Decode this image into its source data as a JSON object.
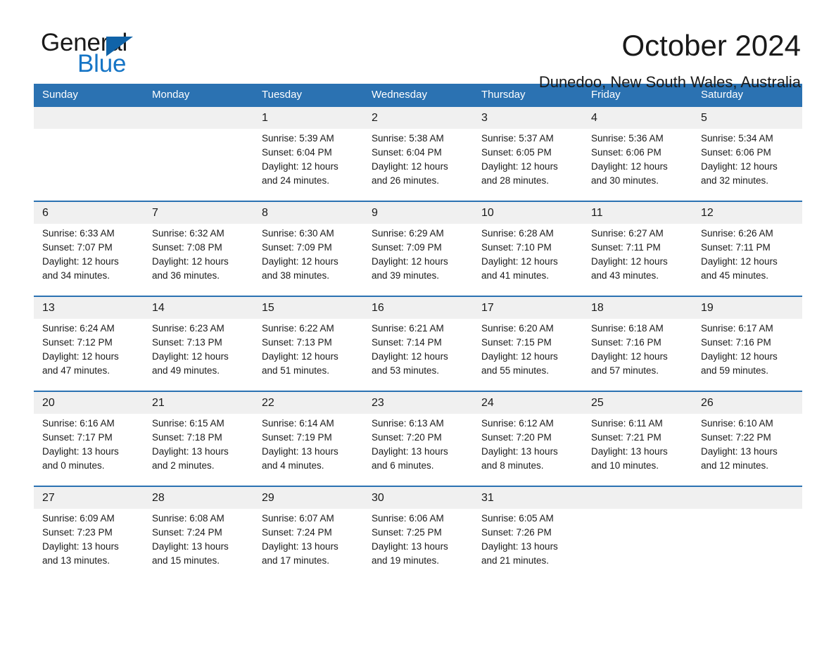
{
  "brand": {
    "word_one": "General",
    "word_two": "Blue",
    "accent_dark": "#1063a8",
    "accent_blue": "#1675c6"
  },
  "header": {
    "title": "October 2024",
    "subtitle": "Dunedoo, New South Wales, Australia"
  },
  "theme": {
    "header_blue": "#2b72b2",
    "daynum_band": "#f0f0f0",
    "cell_white": "#ffffff"
  },
  "calendar": {
    "weekdays": [
      "Sunday",
      "Monday",
      "Tuesday",
      "Wednesday",
      "Thursday",
      "Friday",
      "Saturday"
    ],
    "weeks": [
      [
        {
          "day": "",
          "detail": ""
        },
        {
          "day": "",
          "detail": ""
        },
        {
          "day": "1",
          "detail": "Sunrise: 5:39 AM\nSunset: 6:04 PM\nDaylight: 12 hours\nand 24 minutes."
        },
        {
          "day": "2",
          "detail": "Sunrise: 5:38 AM\nSunset: 6:04 PM\nDaylight: 12 hours\nand 26 minutes."
        },
        {
          "day": "3",
          "detail": "Sunrise: 5:37 AM\nSunset: 6:05 PM\nDaylight: 12 hours\nand 28 minutes."
        },
        {
          "day": "4",
          "detail": "Sunrise: 5:36 AM\nSunset: 6:06 PM\nDaylight: 12 hours\nand 30 minutes."
        },
        {
          "day": "5",
          "detail": "Sunrise: 5:34 AM\nSunset: 6:06 PM\nDaylight: 12 hours\nand 32 minutes."
        }
      ],
      [
        {
          "day": "6",
          "detail": "Sunrise: 6:33 AM\nSunset: 7:07 PM\nDaylight: 12 hours\nand 34 minutes."
        },
        {
          "day": "7",
          "detail": "Sunrise: 6:32 AM\nSunset: 7:08 PM\nDaylight: 12 hours\nand 36 minutes."
        },
        {
          "day": "8",
          "detail": "Sunrise: 6:30 AM\nSunset: 7:09 PM\nDaylight: 12 hours\nand 38 minutes."
        },
        {
          "day": "9",
          "detail": "Sunrise: 6:29 AM\nSunset: 7:09 PM\nDaylight: 12 hours\nand 39 minutes."
        },
        {
          "day": "10",
          "detail": "Sunrise: 6:28 AM\nSunset: 7:10 PM\nDaylight: 12 hours\nand 41 minutes."
        },
        {
          "day": "11",
          "detail": "Sunrise: 6:27 AM\nSunset: 7:11 PM\nDaylight: 12 hours\nand 43 minutes."
        },
        {
          "day": "12",
          "detail": "Sunrise: 6:26 AM\nSunset: 7:11 PM\nDaylight: 12 hours\nand 45 minutes."
        }
      ],
      [
        {
          "day": "13",
          "detail": "Sunrise: 6:24 AM\nSunset: 7:12 PM\nDaylight: 12 hours\nand 47 minutes."
        },
        {
          "day": "14",
          "detail": "Sunrise: 6:23 AM\nSunset: 7:13 PM\nDaylight: 12 hours\nand 49 minutes."
        },
        {
          "day": "15",
          "detail": "Sunrise: 6:22 AM\nSunset: 7:13 PM\nDaylight: 12 hours\nand 51 minutes."
        },
        {
          "day": "16",
          "detail": "Sunrise: 6:21 AM\nSunset: 7:14 PM\nDaylight: 12 hours\nand 53 minutes."
        },
        {
          "day": "17",
          "detail": "Sunrise: 6:20 AM\nSunset: 7:15 PM\nDaylight: 12 hours\nand 55 minutes."
        },
        {
          "day": "18",
          "detail": "Sunrise: 6:18 AM\nSunset: 7:16 PM\nDaylight: 12 hours\nand 57 minutes."
        },
        {
          "day": "19",
          "detail": "Sunrise: 6:17 AM\nSunset: 7:16 PM\nDaylight: 12 hours\nand 59 minutes."
        }
      ],
      [
        {
          "day": "20",
          "detail": "Sunrise: 6:16 AM\nSunset: 7:17 PM\nDaylight: 13 hours\nand 0 minutes."
        },
        {
          "day": "21",
          "detail": "Sunrise: 6:15 AM\nSunset: 7:18 PM\nDaylight: 13 hours\nand 2 minutes."
        },
        {
          "day": "22",
          "detail": "Sunrise: 6:14 AM\nSunset: 7:19 PM\nDaylight: 13 hours\nand 4 minutes."
        },
        {
          "day": "23",
          "detail": "Sunrise: 6:13 AM\nSunset: 7:20 PM\nDaylight: 13 hours\nand 6 minutes."
        },
        {
          "day": "24",
          "detail": "Sunrise: 6:12 AM\nSunset: 7:20 PM\nDaylight: 13 hours\nand 8 minutes."
        },
        {
          "day": "25",
          "detail": "Sunrise: 6:11 AM\nSunset: 7:21 PM\nDaylight: 13 hours\nand 10 minutes."
        },
        {
          "day": "26",
          "detail": "Sunrise: 6:10 AM\nSunset: 7:22 PM\nDaylight: 13 hours\nand 12 minutes."
        }
      ],
      [
        {
          "day": "27",
          "detail": "Sunrise: 6:09 AM\nSunset: 7:23 PM\nDaylight: 13 hours\nand 13 minutes."
        },
        {
          "day": "28",
          "detail": "Sunrise: 6:08 AM\nSunset: 7:24 PM\nDaylight: 13 hours\nand 15 minutes."
        },
        {
          "day": "29",
          "detail": "Sunrise: 6:07 AM\nSunset: 7:24 PM\nDaylight: 13 hours\nand 17 minutes."
        },
        {
          "day": "30",
          "detail": "Sunrise: 6:06 AM\nSunset: 7:25 PM\nDaylight: 13 hours\nand 19 minutes."
        },
        {
          "day": "31",
          "detail": "Sunrise: 6:05 AM\nSunset: 7:26 PM\nDaylight: 13 hours\nand 21 minutes."
        },
        {
          "day": "",
          "detail": ""
        },
        {
          "day": "",
          "detail": ""
        }
      ]
    ]
  }
}
